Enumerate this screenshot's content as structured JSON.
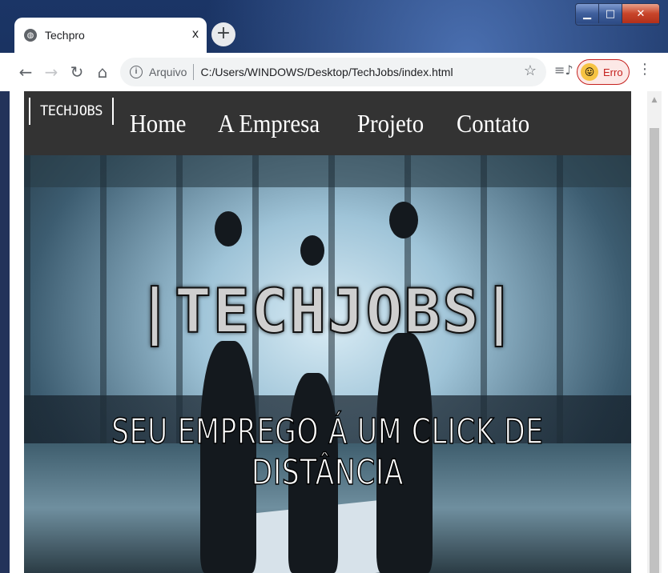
{
  "window": {
    "minimize": "▁",
    "maximize": "□",
    "close": "✕"
  },
  "tab": {
    "title": "Techpro",
    "close": "x",
    "new_tab": "+"
  },
  "toolbar": {
    "back": "←",
    "forward": "→",
    "reload": "↻",
    "home": "⌂",
    "info": "i",
    "scheme_label": "Arquivo",
    "url": "C:/Users/WINDOWS/Desktop/TechJobs/index.html",
    "star": "☆",
    "profile_status": "Erro",
    "menu": "⋮"
  },
  "site": {
    "logo": "TECHJOBS",
    "nav": [
      "Home",
      "A Empresa",
      "Projeto",
      "Contato"
    ],
    "hero_title": "|TECHJOBS|",
    "hero_subtitle": "SEU EMPREGO Á UM CLICK DE DISTÂNCIA"
  },
  "colors": {
    "nav_bg": "#333333",
    "profile_error": "#c5221f"
  }
}
